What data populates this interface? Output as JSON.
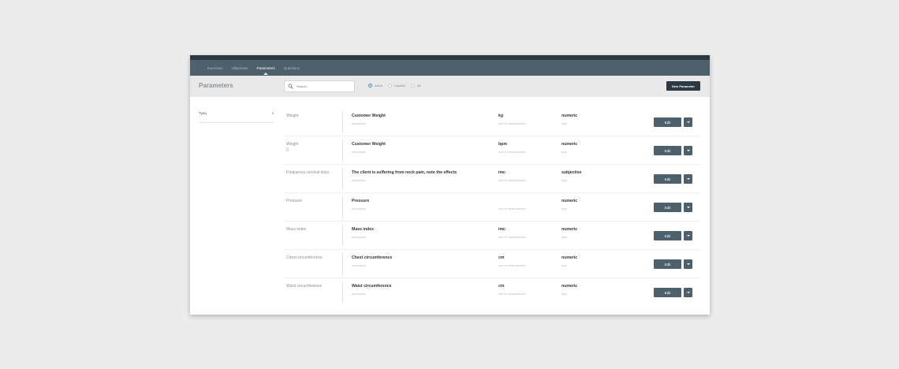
{
  "nav": {
    "items": [
      "Exercises",
      "Objectives",
      "Parameters",
      "Questions"
    ],
    "active_index": 2
  },
  "toolbar": {
    "title": "Parameters",
    "search_placeholder": "Search...",
    "radios": [
      {
        "label": "active",
        "checked": true
      },
      {
        "label": "inactive",
        "checked": false
      },
      {
        "label": "All",
        "checked": false
      }
    ],
    "new_button": "New Parameter"
  },
  "sidebar": {
    "filter_label": "Tyeq",
    "filter_caret": "▾"
  },
  "icons": {
    "search": "search-icon",
    "name_icon": "clipboard-icon",
    "dropdown": "caret-down-icon"
  },
  "colors": {
    "nav_bg": "#4d616c",
    "topbar_bg": "#2c3942",
    "button_bg": "#4d616c",
    "radio_active": "#3a8fd8"
  },
  "row_button_label": "Edit",
  "rows": [
    {
      "name": "Weight",
      "name_icon": "",
      "label": "Customer Weight",
      "description": "description",
      "unit": "kg",
      "unit_sub": "unit of measurement",
      "type": "numeric",
      "type_sub": "type"
    },
    {
      "name": "Weight",
      "name_icon": "▯",
      "label": "Customer Weight",
      "description": "description",
      "unit": "bpm",
      "unit_sub": "unit of measurement",
      "type": "numeric",
      "type_sub": "type"
    },
    {
      "name": "Frequenza cervical dolor",
      "name_icon": "",
      "label": "The client is suffering from neck pain, note the effects",
      "description": "description",
      "unit": "imc",
      "unit_sub": "unit of measurement",
      "type": "subjective",
      "type_sub": "type"
    },
    {
      "name": "Pressure",
      "name_icon": "",
      "label": "Pressure",
      "description": "description",
      "unit": "",
      "unit_sub": "unit of measurement",
      "type": "numeric",
      "type_sub": "type"
    },
    {
      "name": "Mass index",
      "name_icon": "",
      "label": "Mass index",
      "description": "description",
      "unit": "imc",
      "unit_sub": "unit of measurement",
      "type": "numeric",
      "type_sub": "type"
    },
    {
      "name": "Chest circumference",
      "name_icon": "",
      "label": "Chest circumference",
      "description": "description",
      "unit": "cm",
      "unit_sub": "unit of measurement",
      "type": "numeric",
      "type_sub": "type"
    },
    {
      "name": "Waist circumference",
      "name_icon": "",
      "label": "Waist circumference",
      "description": "description",
      "unit": "cm",
      "unit_sub": "unit of measurement",
      "type": "numeric",
      "type_sub": "type"
    }
  ]
}
